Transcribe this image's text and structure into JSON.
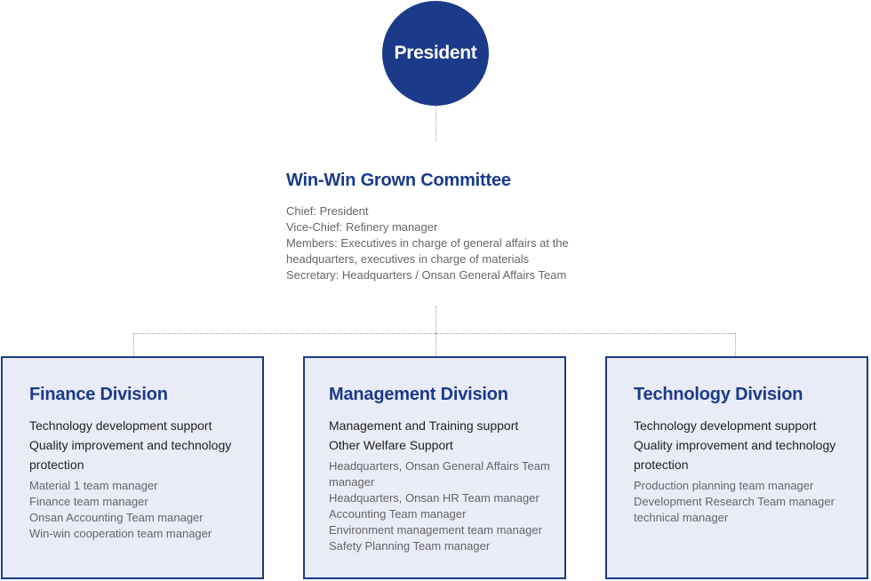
{
  "president": {
    "label": "President"
  },
  "committee": {
    "title": "Win-Win Grown Committee",
    "lines": [
      "Chief: President",
      "Vice-Chief: Refinery manager",
      "Members: Executives in charge of general affairs at the",
      "headquarters, executives in charge of  materials",
      "Secretary: Headquarters / Onsan General Affairs Team"
    ]
  },
  "divisions": [
    {
      "title": "Finance Division",
      "roles": [
        "Technology development support",
        "Quality improvement and technology protection"
      ],
      "members": [
        "Material 1 team manager",
        "Finance team manager",
        "Onsan Accounting Team manager",
        "Win-win cooperation team manager"
      ]
    },
    {
      "title": "Management Division",
      "roles": [
        "Management and Training support",
        "Other Welfare Support"
      ],
      "members": [
        "Headquarters, Onsan General Affairs Team manager",
        "Headquarters, Onsan HR Team manager",
        "Accounting Team manager",
        "Environment management team manager",
        "Safety Planning Team manager"
      ]
    },
    {
      "title": "Technology Division",
      "roles": [
        "Technology development support",
        "Quality improvement and technology protection"
      ],
      "members": [
        "Production planning team manager",
        "Development Research Team manager",
        "technical manager"
      ]
    }
  ],
  "colors": {
    "primary": "#1b3a8a",
    "box_fill": "#e9ebf6",
    "connector": "#9aa0aa"
  }
}
